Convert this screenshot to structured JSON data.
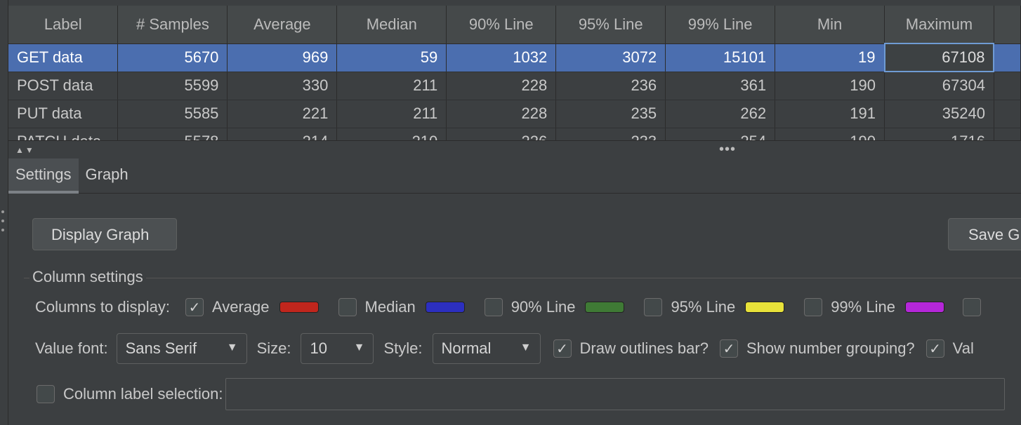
{
  "table": {
    "columns": [
      "Label",
      "# Samples",
      "Average",
      "Median",
      "90% Line",
      "95% Line",
      "99% Line",
      "Min",
      "Maximum"
    ],
    "rows": [
      [
        "GET data",
        "5670",
        "969",
        "59",
        "1032",
        "3072",
        "15101",
        "19",
        "67108"
      ],
      [
        "POST data",
        "5599",
        "330",
        "211",
        "228",
        "236",
        "361",
        "190",
        "67304"
      ],
      [
        "PUT data",
        "5585",
        "221",
        "211",
        "228",
        "235",
        "262",
        "191",
        "35240"
      ],
      [
        "PATCH data",
        "5578",
        "214",
        "210",
        "226",
        "233",
        "254",
        "190",
        "1716"
      ]
    ],
    "selected_row": 0
  },
  "tabs": [
    "Settings",
    "Graph"
  ],
  "buttons": {
    "display_graph": "Display Graph",
    "save_graph": "Save G"
  },
  "column_settings": {
    "title": "Column settings",
    "columns_to_display_label": "Columns to display:",
    "options": [
      {
        "label": "Average",
        "checked": true,
        "color": "#c0261d"
      },
      {
        "label": "Median",
        "checked": false,
        "color": "#2c2fbf"
      },
      {
        "label": "90% Line",
        "checked": false,
        "color": "#3f7a35"
      },
      {
        "label": "95% Line",
        "checked": false,
        "color": "#e8e23a"
      },
      {
        "label": "99% Line",
        "checked": false,
        "color": "#b527d9"
      }
    ],
    "value_font_label": "Value font:",
    "value_font": "Sans Serif",
    "size_label": "Size:",
    "size": "10",
    "style_label": "Style:",
    "style": "Normal",
    "draw_outlines_label": "Draw outlines bar?",
    "show_grouping_label": "Show number grouping?",
    "val_label": "Val",
    "column_label_selection": "Column label selection:"
  }
}
